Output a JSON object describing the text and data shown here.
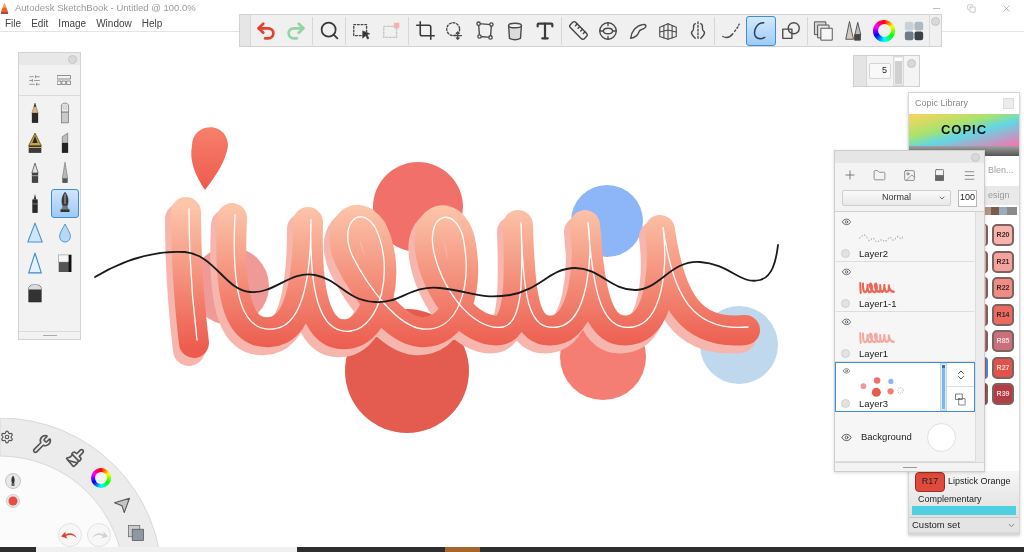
{
  "window": {
    "title": "Autodesk SketchBook - Untitled @ 100.0%"
  },
  "menu": [
    "File",
    "Edit",
    "Image",
    "Window",
    "Help"
  ],
  "toolbar": [
    [
      {
        "kind": "undo",
        "selected": false
      },
      {
        "kind": "redo",
        "selected": false
      }
    ],
    [
      {
        "kind": "zoom",
        "selected": false
      }
    ],
    [
      {
        "kind": "select",
        "selected": false
      },
      {
        "kind": "transform",
        "selected": false
      }
    ],
    [
      {
        "kind": "crop",
        "selected": false
      },
      {
        "kind": "move",
        "selected": false
      },
      {
        "kind": "distort",
        "selected": false
      },
      {
        "kind": "fill",
        "selected": false
      },
      {
        "kind": "text",
        "selected": false
      }
    ],
    [
      {
        "kind": "ruler",
        "selected": false
      },
      {
        "kind": "ellipse",
        "selected": false
      },
      {
        "kind": "curve",
        "selected": false
      },
      {
        "kind": "perspective",
        "selected": false
      },
      {
        "kind": "symmetry",
        "selected": false
      }
    ],
    [
      {
        "kind": "stroke",
        "selected": false
      },
      {
        "kind": "predictive",
        "selected": true
      },
      {
        "kind": "shapes",
        "selected": false
      }
    ],
    [
      {
        "kind": "copic",
        "selected": false
      },
      {
        "kind": "brushes",
        "selected": false
      },
      {
        "kind": "wheel",
        "selected": false
      },
      {
        "kind": "palette",
        "selected": false
      }
    ]
  ],
  "brush_palette": {
    "brushes": [
      {
        "kind": "pencil",
        "selected": false
      },
      {
        "kind": "bristle",
        "selected": false
      },
      {
        "kind": "airbrush",
        "selected": false
      },
      {
        "kind": "chisel",
        "selected": false
      },
      {
        "kind": "ballpoint",
        "selected": false
      },
      {
        "kind": "felt",
        "selected": false
      },
      {
        "kind": "fineliner",
        "selected": false
      },
      {
        "kind": "inkpen",
        "selected": true
      },
      {
        "kind": "smear",
        "selected": false
      },
      {
        "kind": "blur",
        "selected": false
      },
      {
        "kind": "sharpen",
        "selected": false
      },
      {
        "kind": "eraser",
        "selected": false
      },
      {
        "kind": "harderaser",
        "selected": false
      }
    ]
  },
  "brush_size": {
    "value": "5",
    "level": 1
  },
  "layers": {
    "blend_mode": "Normal",
    "opacity": "100",
    "level": 1,
    "items": [
      {
        "name": "Layer2",
        "kind": "line",
        "visible": true,
        "selected": false
      },
      {
        "name": "Layer1-1",
        "kind": "lettering",
        "visible": true,
        "selected": false
      },
      {
        "name": "Layer1",
        "kind": "shadow",
        "visible": true,
        "selected": false
      },
      {
        "name": "Layer3",
        "kind": "dots",
        "visible": true,
        "selected": true
      },
      {
        "name": "Background",
        "kind": "background",
        "visible": true,
        "selected": false
      }
    ]
  },
  "copic_library": {
    "title": "Copic Library",
    "logo": "COPIC",
    "subtitle": "Blen...",
    "tab": "esign",
    "partial_swatches": [
      {
        "color": "#e6bdb6",
        "selected": false
      },
      {
        "color": "#e3aaa4",
        "selected": false
      },
      {
        "color": "#dc9a94",
        "selected": false
      },
      {
        "color": "#d9817b",
        "selected": false
      },
      {
        "color": "#c46a78",
        "selected": false
      },
      {
        "color": "#d9463f",
        "selected": true
      },
      {
        "color": "#a83a44",
        "selected": false
      }
    ],
    "swatches": [
      {
        "label": "R20",
        "color": "#f6b4ad",
        "selected": false
      },
      {
        "label": "R21",
        "color": "#f3a39c",
        "selected": false
      },
      {
        "label": "R22",
        "color": "#ef8c83",
        "selected": false
      },
      {
        "label": "R14",
        "color": "#ec6b60",
        "selected": false
      },
      {
        "label": "R85",
        "color": "#c9707d",
        "selected": false
      },
      {
        "label": "R27",
        "color": "#e0524a",
        "selected": false
      },
      {
        "label": "R39",
        "color": "#b33c45",
        "selected": false
      }
    ],
    "current": {
      "code": "R17",
      "name": "Lipstick Orange"
    },
    "harmony": "Complementary",
    "set": "Custom set"
  }
}
